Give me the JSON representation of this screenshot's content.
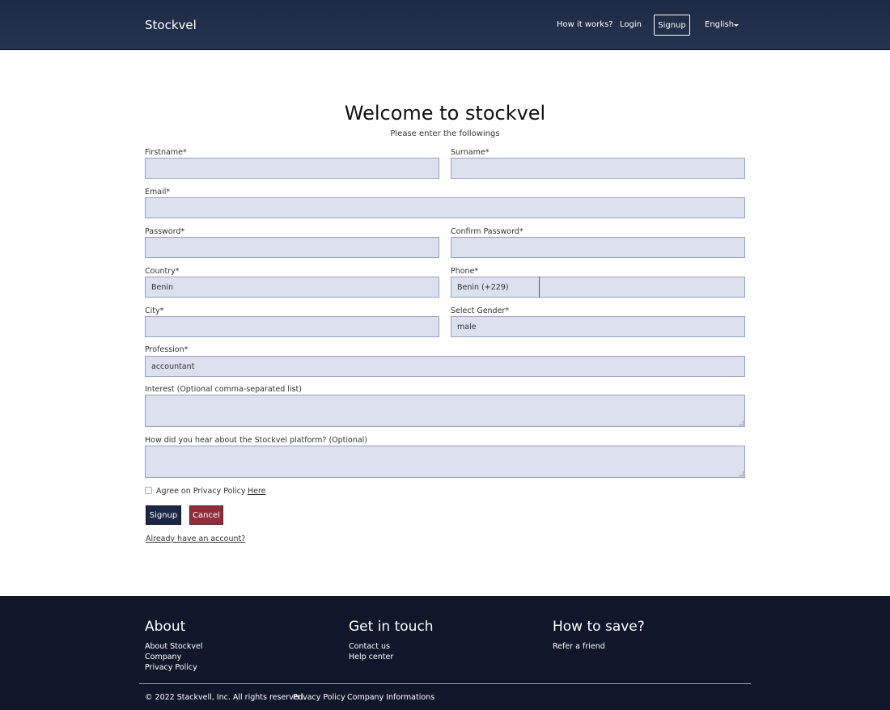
{
  "header": {
    "brand": "Stockvel",
    "how_it_works": "How it works?",
    "login": "Login",
    "signup": "Signup",
    "language": "English"
  },
  "form": {
    "title": "Welcome to stockvel",
    "subtitle": "Please enter the followings",
    "firstname_label": "Firstname*",
    "surname_label": "Surname*",
    "email_label": "Email*",
    "password_label": "Password*",
    "confirm_password_label": "Confirm Password*",
    "country_label": "Country*",
    "country_value": "Benin",
    "phone_label": "Phone*",
    "phone_code_value": "Benin (+229)",
    "city_label": "City*",
    "gender_label": "Select Gender*",
    "gender_value": "male",
    "profession_label": "Profession*",
    "profession_value": "accountant",
    "interest_label": "Interest (Optional comma-separated list)",
    "hear_label": "How did you hear about the Stockvel platform? (Optional)",
    "privacy_label": "Agree on Privacy Policy",
    "privacy_link": "Here",
    "signup_button": "Signup",
    "cancel_button": "Cancel",
    "account_link": "Already have an account?"
  },
  "footer": {
    "about_title": "About",
    "about_links": [
      "About Stockvel",
      "Company",
      "Privacy Policy"
    ],
    "touch_title": "Get in touch",
    "touch_links": [
      "Contact us",
      "Help center"
    ],
    "save_title": "How to save?",
    "save_links": [
      "Refer a friend"
    ],
    "copyright": "© 2022 Stackvell, Inc. All rights reserved.",
    "bottom_privacy": "Privacy Policy",
    "bottom_company": "Company Informations"
  },
  "colors": {
    "navbar": "#1b2a45",
    "footer": "#10172b",
    "input_bg": "#dde1ef",
    "signup_button": "#1c2745",
    "cancel_button": "#8f2d3b"
  }
}
